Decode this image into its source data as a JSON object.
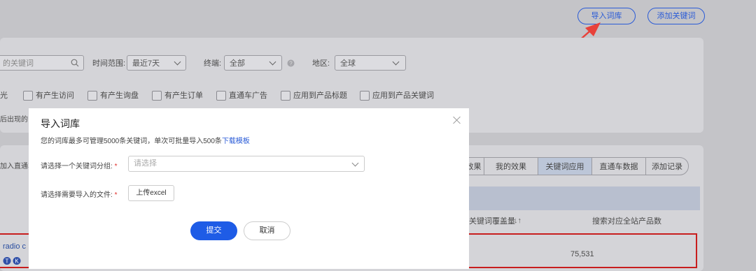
{
  "header": {
    "import_label": "导入词库",
    "add_label": "添加关键词"
  },
  "filters": {
    "search_placeholder": "的关键词",
    "time_label": "时间范围:",
    "time_value": "最近7天",
    "terminal_label": "终端:",
    "terminal_value": "全部",
    "region_label": "地区:",
    "region_value": "全球",
    "checks": [
      "光",
      "有产生访问",
      "有产生询盘",
      "有产生订单",
      "直通车广告",
      "应用到产品标题",
      "应用到产品关键词"
    ],
    "hint": "后出现的"
  },
  "tabs": [
    "效果",
    "我的效果",
    "关键词应用",
    "直通车数据",
    "添加记录"
  ],
  "left_action": "加入直通车",
  "table": {
    "col_coverage": "关键词覆盖量",
    "col_products": "搜索对应全站产品数",
    "row_keyword": "radio c",
    "row_value": "75,531"
  },
  "modal": {
    "title": "导入词库",
    "note": "您的词库最多可管理5000条关键词，单次可批量导入500条",
    "template_link": "下载模板",
    "group_label": "请选择一个关键词分组:",
    "group_placeholder": "请选择",
    "file_label": "请选择需要导入的文件:",
    "required_mark": "*",
    "upload_label": "上传excel",
    "submit_label": "提交",
    "cancel_label": "取消"
  },
  "colors": {
    "accent": "#1e5ce6",
    "arrow": "#e8413a",
    "required": "#e0302c"
  }
}
